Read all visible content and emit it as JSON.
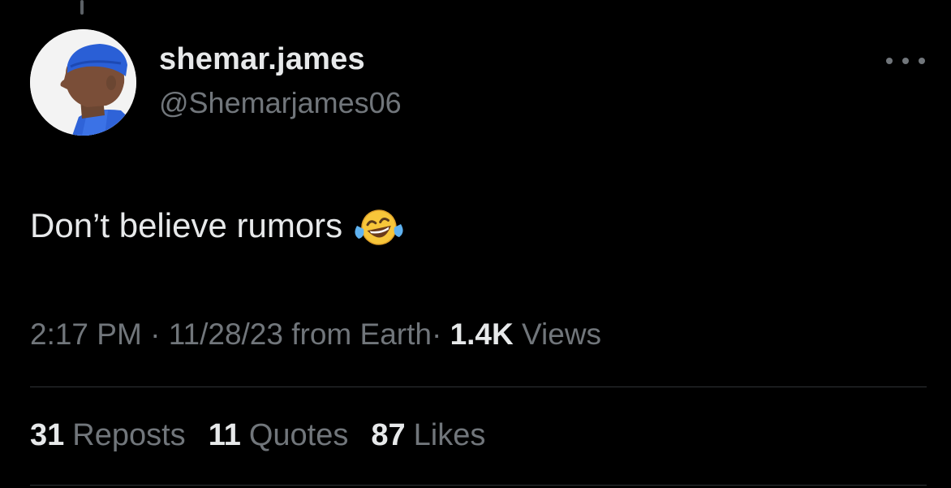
{
  "tweet": {
    "display_name": "shemar.james",
    "handle": "@Shemarjames06",
    "text": "Don’t believe rumors",
    "emoji": "face-with-tears-of-joy",
    "meta": {
      "time": "2:17 PM",
      "date": "11/28/23",
      "source": "from Earth",
      "views_count": "1.4K",
      "views_label": "Views",
      "separator": "·"
    },
    "stats": [
      {
        "count": "31",
        "label": "Reposts"
      },
      {
        "count": "11",
        "label": "Quotes"
      },
      {
        "count": "87",
        "label": "Likes"
      }
    ]
  },
  "colors": {
    "background": "#000000",
    "primary_text": "#e7e9ea",
    "secondary_text": "#71767b",
    "divider": "#2f3336",
    "avatar_accent": "#2f63d8"
  }
}
